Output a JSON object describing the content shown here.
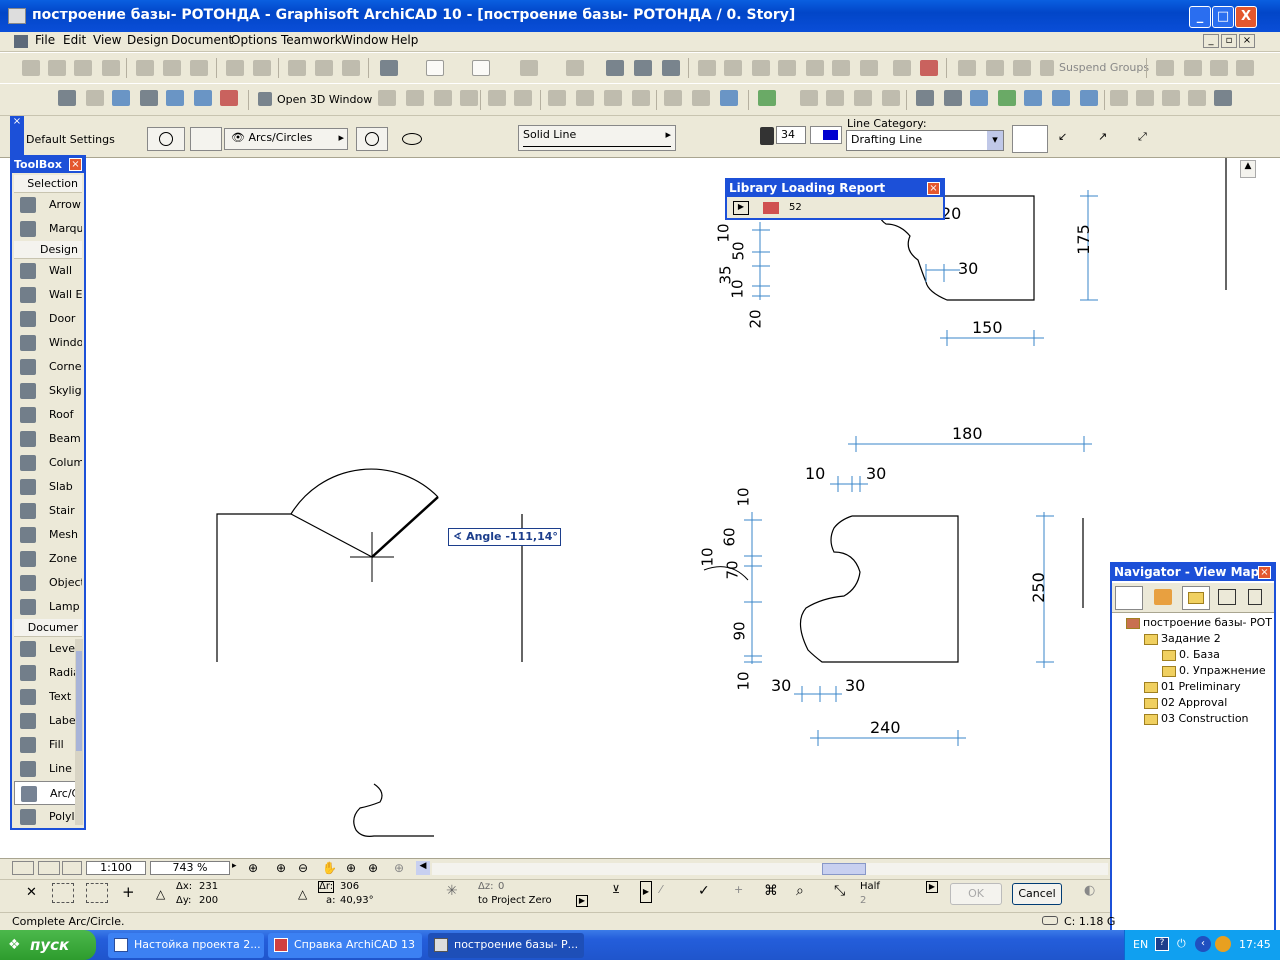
{
  "window": {
    "title": "построение базы- РОТОНДА - Graphisoft ArchiCAD 10 - [построение базы- РОТОНДА / 0. Story]",
    "minimize": "_",
    "maximize": "□",
    "close": "X"
  },
  "menu": [
    "File",
    "Edit",
    "View",
    "Design",
    "Document",
    "Options",
    "Teamwork",
    "Window",
    "Help"
  ],
  "toolbar2": {
    "suspend_groups": "Suspend Groups",
    "open_3d_window": "Open 3D Window"
  },
  "infobox": {
    "default_settings": "Default Settings",
    "geometry_method": "Arcs/Circles",
    "line_type": "Solid Line",
    "pen": "34",
    "line_category_label": "Line Category:",
    "line_category": "Drafting Line"
  },
  "toolbox": {
    "title": "ToolBox",
    "sections": {
      "selection": "Selection",
      "design": "Design",
      "document": "Documer"
    },
    "selection_tools": [
      {
        "label": "Arrow",
        "icon": "arrow-icon"
      },
      {
        "label": "Marque",
        "icon": "marquee-icon"
      }
    ],
    "design_tools": [
      {
        "label": "Wall",
        "icon": "wall-icon"
      },
      {
        "label": "Wall En",
        "icon": "wall-end-icon"
      },
      {
        "label": "Door",
        "icon": "door-icon"
      },
      {
        "label": "Window",
        "icon": "window-icon"
      },
      {
        "label": "Corne.",
        "icon": "corner-window-icon"
      },
      {
        "label": "Skyligh",
        "icon": "skylight-icon"
      },
      {
        "label": "Roof",
        "icon": "roof-icon"
      },
      {
        "label": "Beam",
        "icon": "beam-icon"
      },
      {
        "label": "Column",
        "icon": "column-icon"
      },
      {
        "label": "Slab",
        "icon": "slab-icon"
      },
      {
        "label": "Stair",
        "icon": "stair-icon"
      },
      {
        "label": "Mesh",
        "icon": "mesh-icon"
      },
      {
        "label": "Zone",
        "icon": "zone-icon"
      },
      {
        "label": "Object",
        "icon": "object-icon"
      },
      {
        "label": "Lamp",
        "icon": "lamp-icon"
      }
    ],
    "document_tools": [
      {
        "label": "Level",
        "icon": "level-dimension-icon"
      },
      {
        "label": "Radia",
        "icon": "radial-dimension-icon"
      },
      {
        "label": "Text",
        "icon": "text-icon"
      },
      {
        "label": "Label",
        "icon": "label-icon"
      },
      {
        "label": "Fill",
        "icon": "fill-icon"
      },
      {
        "label": "Line",
        "icon": "line-icon"
      },
      {
        "label": "Arc/C",
        "icon": "arc-circle-icon"
      },
      {
        "label": "Polylin",
        "icon": "polyline-icon"
      }
    ]
  },
  "library_report": {
    "title": "Library Loading Report",
    "count": "52"
  },
  "tooltip": {
    "angle_label": "Angle",
    "angle_value": "-111,14°"
  },
  "dimensions": {
    "top": {
      "d20": "20",
      "d30": "30",
      "d175": "175",
      "d150": "150",
      "left_stack": [
        "10",
        "50",
        "35",
        "10",
        "20"
      ]
    },
    "middle": {
      "d180": "180",
      "d10": "10",
      "d30": "30",
      "left_a": "10",
      "left_b": "60",
      "left_c": "10",
      "left_d": "70",
      "left_e": "90",
      "left_f": "10",
      "d250": "250",
      "bottom_left": "30",
      "bottom_right": "30",
      "d240": "240"
    }
  },
  "navigator": {
    "title": "Navigator - View Map",
    "tree": [
      {
        "label": "построение базы- РОТ",
        "level": 0
      },
      {
        "label": "Задание 2",
        "level": 1
      },
      {
        "label": "0. База",
        "level": 2
      },
      {
        "label": "0. Упражнение",
        "level": 2
      },
      {
        "label": "01 Preliminary",
        "level": 1
      },
      {
        "label": "02 Approval",
        "level": 1
      },
      {
        "label": "03 Construction",
        "level": 1
      }
    ]
  },
  "bottom": {
    "scale": "1:100",
    "zoom": "743 %",
    "dx_label": "Δx:",
    "dx": "231",
    "dy_label": "Δy:",
    "dy": "200",
    "r_label": "Δr:",
    "r": "306",
    "a_label": "a:",
    "a": "40,93°",
    "dz_label": "Δz:",
    "dz": "0",
    "to_project_zero": "to Project Zero",
    "half": "Half",
    "half_val": "2",
    "ok": "OK",
    "cancel": "Cancel"
  },
  "status": {
    "message": "Complete Arc/Circle.",
    "disk": "C: 1.18 G"
  },
  "taskbar": {
    "start": "пуск",
    "tasks": [
      "Настойка проекта 2...",
      "Справка ArchiCAD 13",
      "построение базы- Р..."
    ],
    "lang": "EN",
    "time": "17:45"
  },
  "colors": {
    "xp_blue": "#1c50d8",
    "dim_line": "#3a86c8",
    "taskbar_blue": "#245edb",
    "start_green": "#2e9c2e"
  }
}
